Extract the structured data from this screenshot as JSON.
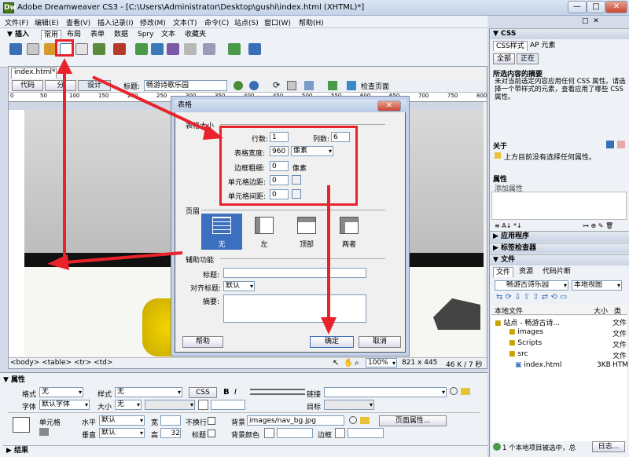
{
  "window": {
    "title": "Adobe Dreamweaver CS3 - [C:\\Users\\Administrator\\Desktop\\gushi\\index.html (XHTML)*]",
    "min": "—",
    "max": "□",
    "close": "✕",
    "restore": "□",
    "dclose": "✕"
  },
  "menu": [
    "文件(F)",
    "编辑(E)",
    "查看(V)",
    "插入记录(I)",
    "修改(M)",
    "文本(T)",
    "命令(C)",
    "站点(S)",
    "窗口(W)",
    "帮助(H)"
  ],
  "insert": {
    "title": "▼ 插入",
    "tabs": [
      "常用",
      "布局",
      "表单",
      "数据",
      "Spry",
      "文本",
      "收藏夹"
    ]
  },
  "doc": {
    "tab": "index.html*",
    "code": "代码",
    "split": "分",
    "design": "设计",
    "title_label": "标题:",
    "title_value": "畅游诗歌乐园",
    "check": "检查页面",
    "ruler": [
      "0",
      "50",
      "100",
      "150",
      "200",
      "250",
      "300",
      "350",
      "400",
      "450",
      "500",
      "550",
      "600",
      "650",
      "700",
      "750",
      "800"
    ],
    "status_path": "<body> <table> <tr> <td>",
    "zoom": "100%",
    "size": "821 x 445",
    "weight": "46 K / 7 秒"
  },
  "dialog": {
    "title": "表格",
    "section_size": "表格大小",
    "rows_label": "行数:",
    "rows": "1",
    "cols_label": "列数:",
    "cols": "6",
    "width_label": "表格宽度:",
    "width": "960",
    "width_unit": "像素",
    "border_label": "边框粗细:",
    "border": "0",
    "border_unit": "像素",
    "padding_label": "单元格边距:",
    "padding": "0",
    "spacing_label": "单元格间距:",
    "spacing": "0",
    "section_header": "页眉",
    "headers": [
      "无",
      "左",
      "顶部",
      "两者"
    ],
    "section_access": "辅助功能",
    "caption_label": "标题:",
    "align_label": "对齐标题:",
    "align_value": "默认",
    "summary_label": "摘要:",
    "help": "帮助",
    "ok": "确定",
    "cancel": "取消"
  },
  "props": {
    "title": "▼ 属性",
    "format_label": "格式",
    "format": "无",
    "style_label": "样式",
    "style": "无",
    "css": "CSS",
    "bold": "B",
    "italic": "I",
    "link_label": "链接",
    "font_label": "字体",
    "font": "默认字体",
    "size_label": "大小",
    "size": "无",
    "target_label": "目标",
    "cell_label": "单元格",
    "horz_label": "水平",
    "horz": "默认",
    "vert_label": "垂直",
    "vert": "默认",
    "w_label": "宽",
    "h_label": "高",
    "h": "32",
    "nowrap_label": "不换行",
    "header_label": "标题",
    "bg_label": "背景",
    "bg": "images/nav_bg.jpg",
    "bgcolor_label": "背景颜色",
    "border_label": "边框",
    "page_props": "页面属性...",
    "results": "▶ 结果"
  },
  "right": {
    "css_title": "▼ CSS",
    "css_tabs": [
      "CSS样式",
      "AP 元素"
    ],
    "mode": [
      "全部",
      "正在"
    ],
    "summary_title": "所选内容的摘要",
    "summary_text": "未对当前选定内容应用任何 CSS 属性。请选择一个带样式的元素，查看应用了哪些 CSS 属性。",
    "about_title": "关于",
    "about_text": "上方目前没有选择任何属性。",
    "attr_title": "属性",
    "add_attr": "添加属性",
    "app_title": "▶ 应用程序",
    "tag_title": "▶ 标签检查器",
    "files_title": "▼ 文件",
    "files_tabs": [
      "文件",
      "资源",
      "代码片断"
    ],
    "site": "畅游古诗乐园",
    "view": "本地视图",
    "cols": [
      "本地文件",
      "大小",
      "类"
    ],
    "tree": [
      {
        "name": "站点 - 畅游古诗...",
        "size": "",
        "type": "文件"
      },
      {
        "name": "images",
        "size": "",
        "type": "文件"
      },
      {
        "name": "Scripts",
        "size": "",
        "type": "文件"
      },
      {
        "name": "src",
        "size": "",
        "type": "文件"
      },
      {
        "name": "index.html",
        "size": "3KB",
        "type": "HTM"
      }
    ],
    "status": "1 个本地项目被选中，总",
    "log": "日志..."
  }
}
